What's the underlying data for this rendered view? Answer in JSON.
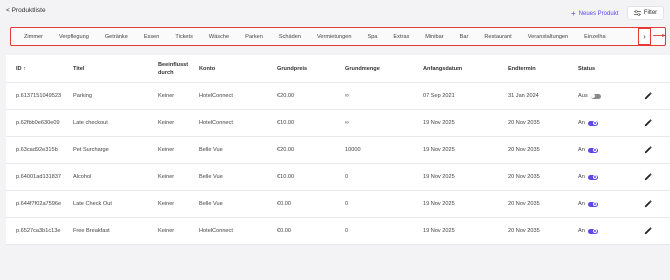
{
  "header": {
    "back_label": "< Produktliste",
    "new_product_label": "Neues Produkt",
    "filter_label": "Filter"
  },
  "categories": [
    "Zimmer",
    "Verpflegung",
    "Getränke",
    "Essen",
    "Tickets",
    "Wäsche",
    "Parken",
    "Schäden",
    "Vermietungen",
    "Spa",
    "Extras",
    "Minibar",
    "Bar",
    "Restaurant",
    "Veranstaltungen",
    "Einzelha"
  ],
  "table": {
    "columns": [
      "ID ↑",
      "Titel",
      "Beeinflusst durch",
      "Konto",
      "Grundpreis",
      "Grundmenge",
      "Anfangsdatum",
      "Endtermin",
      "Status"
    ],
    "rows": [
      {
        "id": "p.613715104952​3",
        "title": "Parking",
        "influenced": "Keiner",
        "konto": "HotelConnect",
        "price": "€20.00",
        "qty": "∞",
        "start": "07 Sep 2021",
        "end": "31 Jan 2024",
        "status": "Aus",
        "on": false
      },
      {
        "id": "p.62fbb0e630e09",
        "title": "Late checkout",
        "influenced": "Keiner",
        "konto": "HotelConnect",
        "price": "€10.00",
        "qty": "∞",
        "start": "19 Nov 2025",
        "end": "20 Nov 2035",
        "status": "An",
        "on": true
      },
      {
        "id": "p.63cad92e315b",
        "title": "Pet Surcharge",
        "influenced": "Keiner",
        "konto": "Belle Vue",
        "price": "€20.00",
        "qty": "10000",
        "start": "19 Nov 2025",
        "end": "20 Nov 2035",
        "status": "An",
        "on": true
      },
      {
        "id": "p.64001ad131837",
        "title": "Alcohol",
        "influenced": "Keiner",
        "konto": "Belle Vue",
        "price": "€10.00",
        "qty": "0",
        "start": "19 Nov 2025",
        "end": "20 Nov 2035",
        "status": "An",
        "on": true
      },
      {
        "id": "p.644f7f02a7596e",
        "title": "Late Check Out",
        "influenced": "Keiner",
        "konto": "Belle Vue",
        "price": "€0.00",
        "qty": "0",
        "start": "19 Nov 2025",
        "end": "20 Nov 2035",
        "status": "An",
        "on": true
      },
      {
        "id": "p.6527ca3b1c13e",
        "title": "Free Breakfast",
        "influenced": "Keiner",
        "konto": "HotelConnect",
        "price": "€0.00",
        "qty": "0",
        "start": "19 Nov 2025",
        "end": "20 Nov 2035",
        "status": "An",
        "on": true
      }
    ]
  },
  "icons": {
    "filter": "filter-sliders-icon",
    "next": "chevron-right-icon",
    "edit": "pencil-icon",
    "add": "plus-icon"
  },
  "colors": {
    "accent": "#5b49e9",
    "highlight": "#e53935"
  }
}
